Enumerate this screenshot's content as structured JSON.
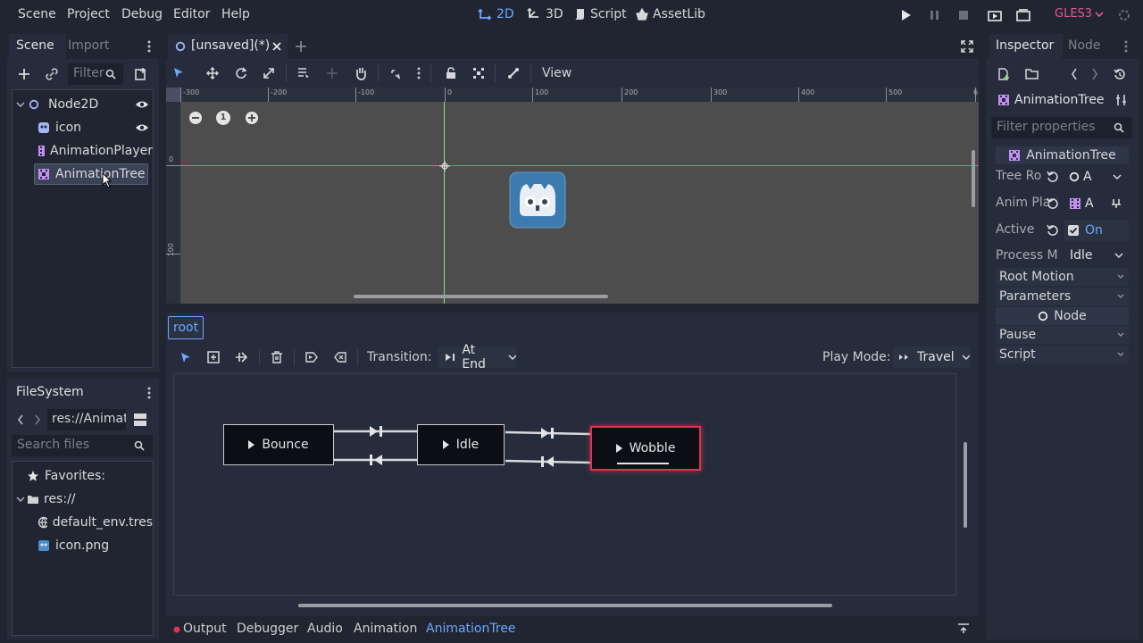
{
  "menu": [
    "Scene",
    "Project",
    "Debug",
    "Editor",
    "Help"
  ],
  "workspaces": {
    "w2d": "2D",
    "w3d": "3D",
    "script": "Script",
    "assetlib": "AssetLib"
  },
  "renderer": "GLES3",
  "scene_dock": {
    "tab_scene": "Scene",
    "tab_import": "Import",
    "filter_placeholder": "Filter",
    "tree": [
      {
        "label": "Node2D"
      },
      {
        "label": "icon"
      },
      {
        "label": "AnimationPlayer"
      },
      {
        "label": "AnimationTree"
      }
    ]
  },
  "filesystem": {
    "title": "FileSystem",
    "path": "res://Animat",
    "search_placeholder": "Search files",
    "items": [
      "Favorites:",
      "res://",
      "default_env.tres",
      "icon.png"
    ]
  },
  "editor": {
    "tab_label": "[unsaved](*)",
    "view_menu": "View",
    "ruler_labels": [
      "-300",
      "-200",
      "-100",
      "0",
      "100",
      "200",
      "300",
      "400",
      "500",
      "6"
    ],
    "vruler_labels": [
      "0",
      "100"
    ],
    "zoom_label": "1"
  },
  "anim_tree": {
    "breadcrumb": "root",
    "transition_label": "Transition:",
    "transition_value": "At End",
    "play_mode_label": "Play Mode:",
    "play_mode_value": "Travel",
    "states": [
      "Bounce",
      "Idle",
      "Wobble"
    ],
    "active_state": "Wobble"
  },
  "bottom_tabs": [
    "Output",
    "Debugger",
    "Audio",
    "Animation",
    "AnimationTree"
  ],
  "active_bottom_tab": "AnimationTree",
  "inspector": {
    "tab_inspector": "Inspector",
    "tab_node": "Node",
    "object_name": "AnimationTree",
    "filter_placeholder": "Filter properties",
    "class_header": "AnimationTree",
    "props": [
      {
        "label": "Tree Ro",
        "value": "A"
      },
      {
        "label": "Anim Pla",
        "value": "A"
      },
      {
        "label": "Active",
        "value": "On"
      },
      {
        "label": "Process M",
        "value": "Idle"
      }
    ],
    "sections": [
      "Root Motion",
      "Parameters"
    ],
    "node_header": "Node",
    "sections2": [
      "Pause",
      "Script"
    ]
  },
  "colors": {
    "accent": "#6ea7ff",
    "renderer": "#e0578f",
    "active_state_border": "#e0334f"
  }
}
